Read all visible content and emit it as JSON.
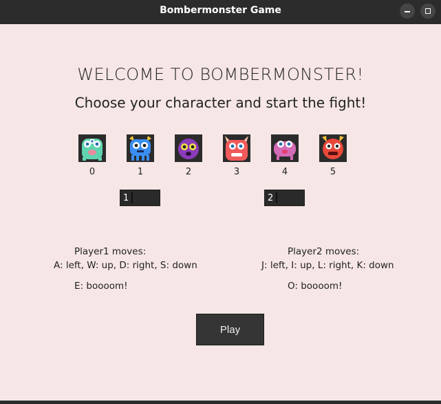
{
  "window": {
    "title": "Bombermonster Game"
  },
  "welcome": {
    "heading": "WELCOME TO BOMBERMONSTER!",
    "subheading": "Choose your character and start the fight!"
  },
  "characters": [
    {
      "label": "0",
      "color": "#5fd4b0",
      "icon": "green-monster-icon"
    },
    {
      "label": "1",
      "color": "#3a8ef0",
      "icon": "blue-monster-icon"
    },
    {
      "label": "2",
      "color": "#8a3bb8",
      "icon": "purple-monster-icon"
    },
    {
      "label": "3",
      "color": "#f05a5a",
      "icon": "red-horned-monster-icon"
    },
    {
      "label": "4",
      "color": "#d36bb6",
      "icon": "pink-monster-icon"
    },
    {
      "label": "5",
      "color": "#e8483a",
      "icon": "red-furry-monster-icon"
    }
  ],
  "player1": {
    "selection": "1",
    "moves_title": "Player1 moves:",
    "moves": "A: left, W: up, D: right, S: down",
    "bomb": "E: boooom!"
  },
  "player2": {
    "selection": "2",
    "moves_title": "Player2 moves:",
    "moves": "J: left, I: up, L: right, K: down",
    "bomb": "O: boooom!"
  },
  "play_button": {
    "label": "Play"
  }
}
